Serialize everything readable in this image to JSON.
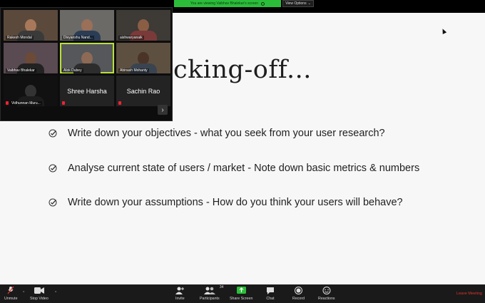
{
  "banner": {
    "share_text": "You are viewing Vaibhav Bhalekar's screen",
    "view_options": "View Options"
  },
  "slide": {
    "title": "cking-off...",
    "bullets": [
      "Write down your objectives - what you seek from your user research?",
      "Analyse current state of users / market - Note down basic metrics & numbers",
      "Write down your assumptions - How do you think your users will behave?"
    ]
  },
  "gallery": {
    "participants": [
      {
        "name": "Rakesh Mondal"
      },
      {
        "name": "Divyanshu Nand..."
      },
      {
        "name": "aishwaryanaik"
      },
      {
        "name": "Vaibhav Bhalekar"
      },
      {
        "name": "Alok Dubey"
      },
      {
        "name": "Abinash Mohanty"
      },
      {
        "name": "Vidhunnan Muru..."
      },
      {
        "name": "Shree Harsha"
      },
      {
        "name": "Sachin Rao"
      }
    ],
    "next_icon": "chevron-right-icon"
  },
  "toolbar": {
    "unmute": "Unmute",
    "stop_video": "Stop Video",
    "invite": "Invite",
    "participants": "Participants",
    "participants_count": "34",
    "share_screen": "Share Screen",
    "chat": "Chat",
    "record": "Record",
    "reactions": "Reactions",
    "leave": "Leave Meeting"
  },
  "colors": {
    "share_green": "#2bbd3a",
    "active_speaker": "#b9e03a",
    "leave_red": "#e0342a"
  }
}
